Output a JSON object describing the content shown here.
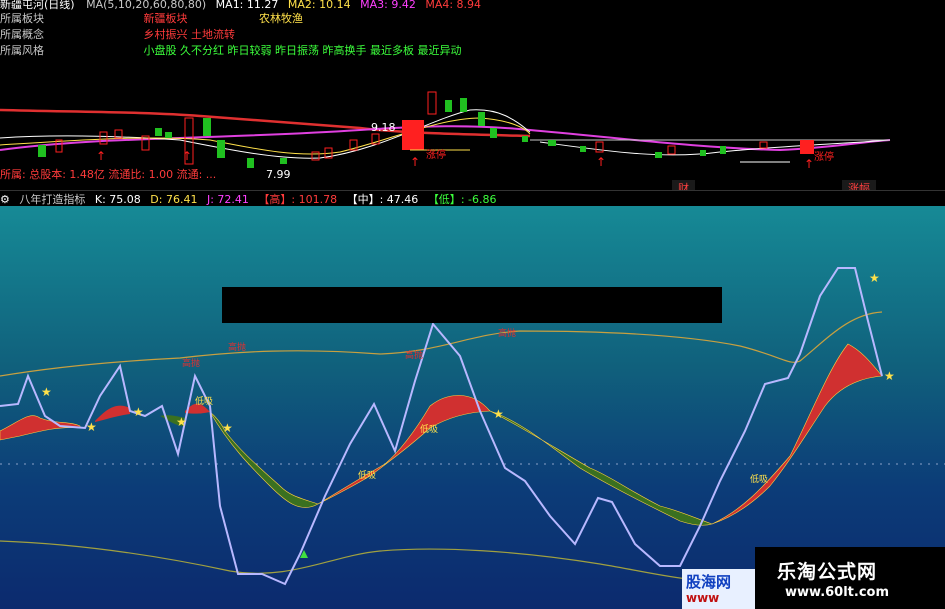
{
  "header": {
    "title": "新疆屯河(日线)",
    "ma_label": "MA(5,10,20,60,80,80)",
    "ma1": "MA1: 11.27",
    "ma2": "MA2: 10.14",
    "ma3": "MA3: 9.42",
    "ma4": "MA4: 8.94"
  },
  "rows": [
    {
      "label": "所属板块",
      "v1": "新疆板块",
      "v2": "农林牧渔"
    },
    {
      "label": "所属概念",
      "v1": "乡村振兴 土地流转",
      "v2": ""
    },
    {
      "label": "所属风格",
      "v1": "小盘股 久不分红 昨日较弱 昨日振荡 昨高换手 最近多板 最近异动",
      "v2": ""
    }
  ],
  "price_labels": {
    "high": "9.18",
    "low": "7.99",
    "tag_a": "涨停",
    "tag_b": "涨停"
  },
  "status": "所属: 总股本: 1.48亿 流通比: 1.00 流通: ...",
  "tags": [
    "财",
    "涨幅"
  ],
  "indicator": {
    "name": "八年打造指标",
    "k": "K: 75.08",
    "d": "D: 76.41",
    "j": "J: 72.41",
    "high_label": "【高】",
    "high_val": ": 101.78",
    "mid_label": "【中】",
    "mid_val": ": 47.46",
    "low_label": "【低】",
    "low_val": ": -6.86"
  },
  "annotations": {
    "low_absorb": "低吸",
    "high_sell": "高抛"
  },
  "watermark": {
    "main_title": "乐淘公式网",
    "main_url": "www.60lt.com",
    "side_title": "股海网",
    "side_url": "www"
  },
  "colors": {
    "up": "#ff2020",
    "down": "#20c020",
    "ma_red": "#e03030",
    "ma_magenta": "#e040e0",
    "kdj_line": "#b0b0ff",
    "band": "#c8a040"
  }
}
